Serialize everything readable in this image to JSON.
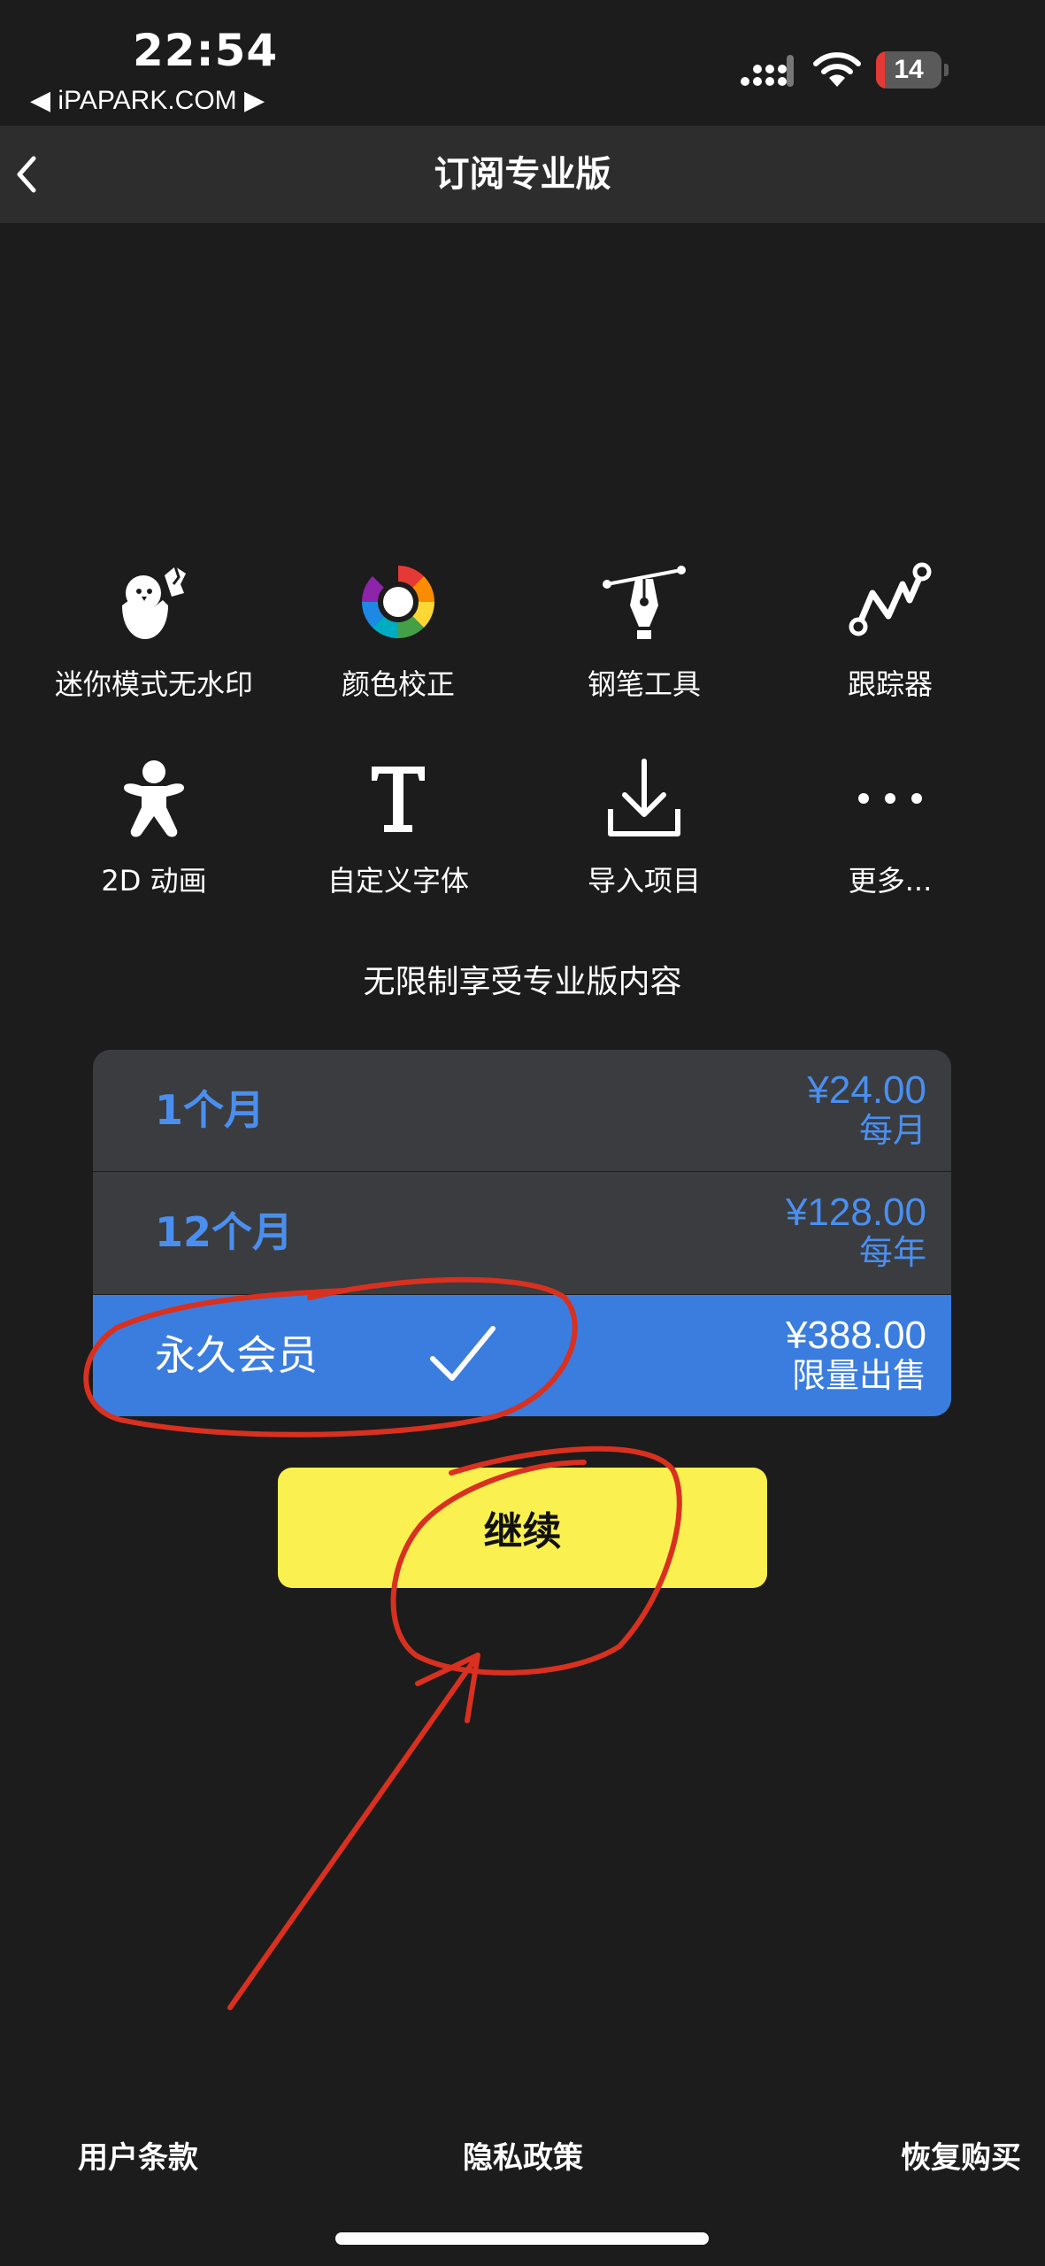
{
  "status_bar": {
    "time": "22:54",
    "carrier": "◀ iPAPARK.COM ▶",
    "battery_level": "14",
    "battery_fraction": 0.14
  },
  "nav": {
    "title": "订阅专业版"
  },
  "features": [
    {
      "label": "迷你模式无水印",
      "icon": "egg-chick-icon"
    },
    {
      "label": "颜色校正",
      "icon": "color-wheel-icon"
    },
    {
      "label": "钢笔工具",
      "icon": "pen-tool-icon"
    },
    {
      "label": "跟踪器",
      "icon": "tracker-icon"
    },
    {
      "label": "2D 动画",
      "icon": "figure-icon"
    },
    {
      "label": "自定义字体",
      "icon": "font-icon"
    },
    {
      "label": "导入项目",
      "icon": "import-icon"
    },
    {
      "label": "更多...",
      "icon": "more-icon"
    }
  ],
  "promo_text": "无限制享受专业版内容",
  "plans": [
    {
      "name": "1个月",
      "price": "¥24.00",
      "period": "每月",
      "selected": false
    },
    {
      "name": "12个月",
      "price": "¥128.00",
      "period": "每年",
      "selected": false
    },
    {
      "name": "永久会员",
      "price": "¥388.00",
      "period": "限量出售",
      "selected": true
    }
  ],
  "continue_label": "继续",
  "footer": {
    "terms": "用户条款",
    "privacy": "隐私政策",
    "restore": "恢复购买"
  },
  "colors": {
    "background": "#1c1c1c",
    "accent_blue": "#3b7dde",
    "continue_yellow": "#faf04f",
    "annotation_red": "#d9301f"
  }
}
